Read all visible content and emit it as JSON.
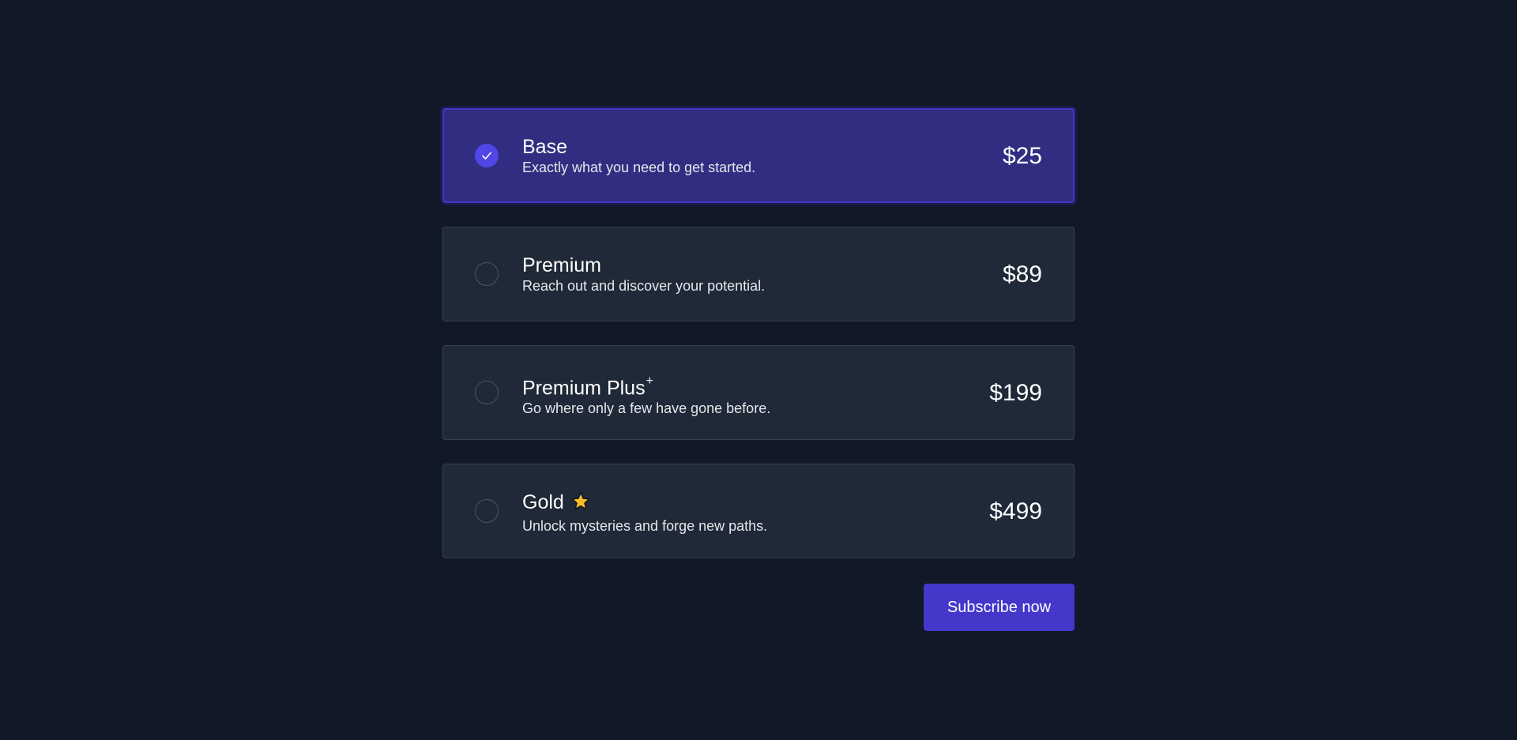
{
  "plans": [
    {
      "name": "Base",
      "suffix": "",
      "badge_icon": "",
      "description": "Exactly what you need to get started.",
      "price": "$25",
      "selected": true
    },
    {
      "name": "Premium",
      "suffix": "",
      "badge_icon": "",
      "description": "Reach out and discover your potential.",
      "price": "$89",
      "selected": false
    },
    {
      "name": "Premium Plus",
      "suffix": "+",
      "badge_icon": "",
      "description": "Go where only a few have gone before.",
      "price": "$199",
      "selected": false
    },
    {
      "name": "Gold",
      "suffix": "",
      "badge_icon": "star-icon",
      "description": "Unlock mysteries and forge new paths.",
      "price": "$499",
      "selected": false
    }
  ],
  "subscribe_label": "Subscribe now",
  "colors": {
    "background": "#111827",
    "card": "#1f2937",
    "card_border": "#374151",
    "selected_card": "#312e81",
    "accent": "#4f46e5",
    "button": "#4338ca",
    "star": "#fbbf24"
  }
}
